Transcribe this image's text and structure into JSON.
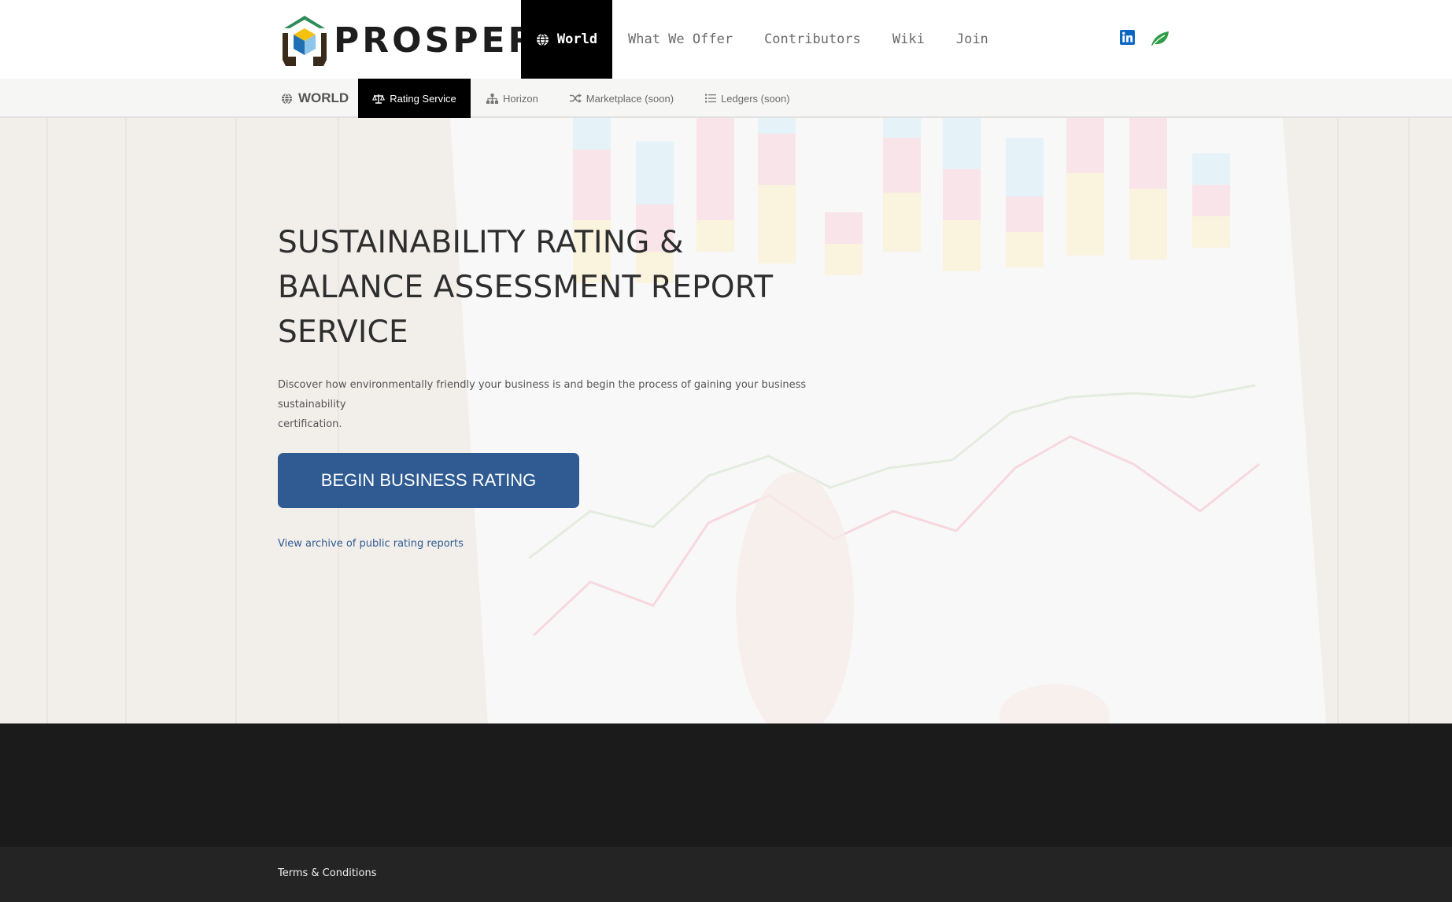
{
  "brand": {
    "name": "PROSPER"
  },
  "main_nav": {
    "items": [
      {
        "label": "World",
        "active": true
      },
      {
        "label": "What We Offer"
      },
      {
        "label": "Contributors"
      },
      {
        "label": "Wiki"
      },
      {
        "label": "Join"
      }
    ]
  },
  "social": {
    "linkedin_icon": "linkedin-icon",
    "leaf_icon": "leaf-icon"
  },
  "sub_nav": {
    "section_title": "WORLD",
    "tabs": [
      {
        "label": "Rating Service",
        "icon": "scale-icon",
        "active": true
      },
      {
        "label": "Horizon",
        "icon": "sitemap-icon"
      },
      {
        "label": "Marketplace (soon)",
        "icon": "shuffle-icon"
      },
      {
        "label": "Ledgers (soon)",
        "icon": "list-icon"
      }
    ]
  },
  "hero": {
    "title_lines": [
      "SUSTAINABILITY RATING &",
      "BALANCE ASSESSMENT REPORT",
      "SERVICE"
    ],
    "description_line1": "Discover how environmentally friendly your business is and begin the process of gaining your business sustainability",
    "description_line2": "certification.",
    "cta_label": "BEGIN BUSINESS RATING",
    "archive_link": "View archive of public rating reports"
  },
  "footer": {
    "terms_link": "Terms & Conditions"
  },
  "colors": {
    "accent": "#2f5b92",
    "active_nav_bg": "#000000",
    "footer_dark": "#1b1b1b",
    "footer_bottom": "#242424",
    "linkedin": "#0a66c2",
    "leaf": "#2e9e47"
  }
}
